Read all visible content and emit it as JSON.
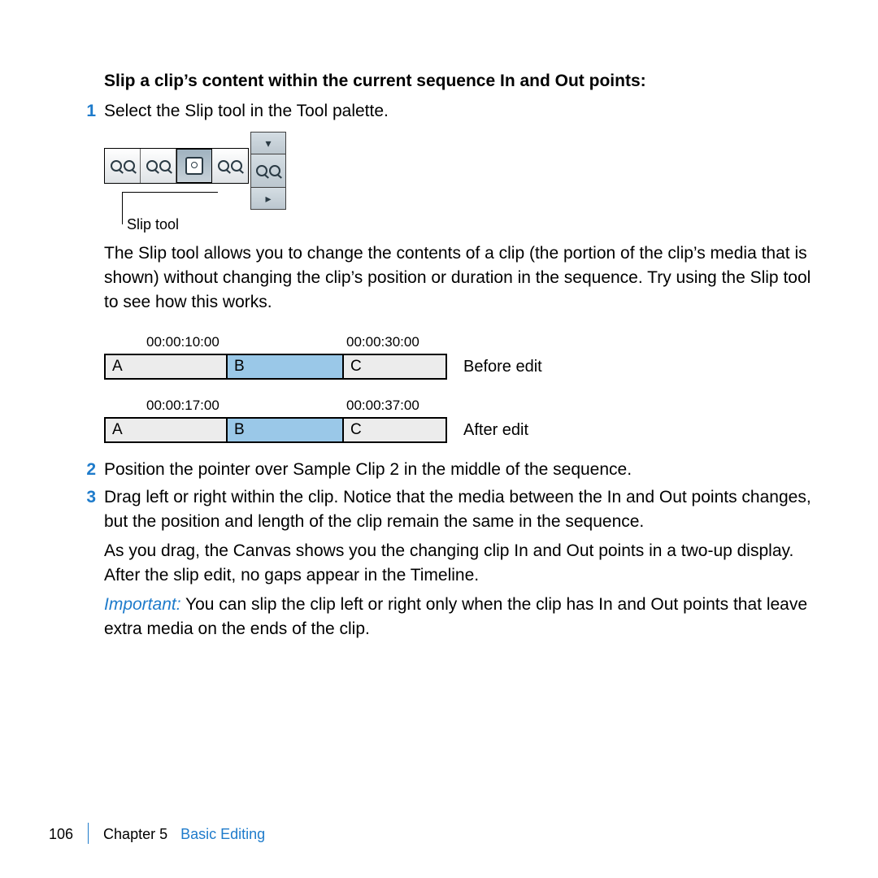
{
  "heading": "Slip a clip’s content within the current sequence In and Out points:",
  "steps": {
    "1": {
      "num": "1",
      "text": "Select the Slip tool in the Tool palette."
    },
    "2": {
      "num": "2",
      "text": "Position the pointer over Sample Clip 2 in the middle of the sequence."
    },
    "3": {
      "num": "3",
      "text": "Drag left or right within the clip. Notice that the media between the In and Out points changes, but the position and length of the clip remain the same in the sequence."
    }
  },
  "tool_callout": "Slip tool",
  "para_slip_desc": "The Slip tool allows you to change the contents of a clip (the portion of the clip’s media that is shown) without changing the clip’s position or duration in the sequence. Try using the Slip tool to see how this works.",
  "timeline": {
    "before": {
      "tc_in": "00:00:10:00",
      "tc_out": "00:00:30:00",
      "A": "A",
      "B": "B",
      "C": "C",
      "label": "Before edit"
    },
    "after": {
      "tc_in": "00:00:17:00",
      "tc_out": "00:00:37:00",
      "A": "A",
      "B": "B",
      "C": "C",
      "label": "After edit"
    }
  },
  "para_drag_result": "As you drag, the Canvas shows you the changing clip In and Out points in a two-up display. After the slip edit, no gaps appear in the Timeline.",
  "important_label": "Important:",
  "important_text": "  You can slip the clip left or right only when the clip has In and Out points that leave extra media on the ends of the clip.",
  "footer": {
    "page": "106",
    "chapter": "Chapter 5",
    "title": "Basic Editing"
  }
}
